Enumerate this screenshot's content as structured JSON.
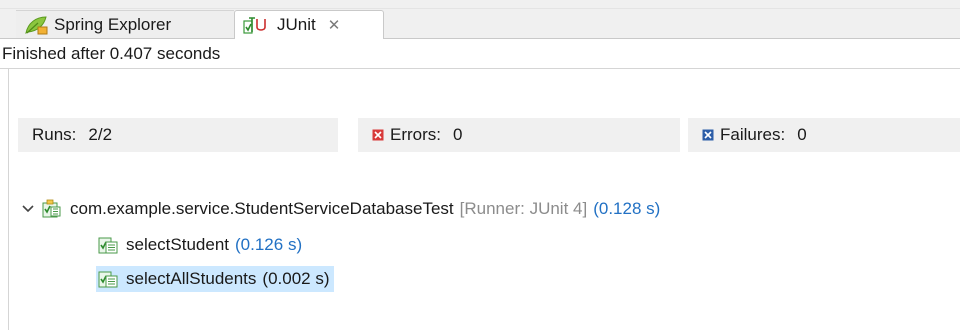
{
  "tabs": [
    {
      "label": "Spring Explorer",
      "active": false,
      "icon": "spring-leaf-icon"
    },
    {
      "label": "JUnit",
      "active": true,
      "icon": "junit-icon",
      "close_glyph": "✕"
    }
  ],
  "status": "Finished after 0.407 seconds",
  "counters": {
    "runs_label": "Runs:",
    "runs_value": "2/2",
    "errors_label": "Errors:",
    "errors_value": "0",
    "failures_label": "Failures:",
    "failures_value": "0"
  },
  "tree": {
    "suite": {
      "label": "com.example.service.StudentServiceDatabaseTest",
      "runner": "[Runner: JUnit 4]",
      "time": "(0.128 s)",
      "expanded": true
    },
    "tests": [
      {
        "label": "selectStudent",
        "time": "(0.126 s)",
        "selected": false
      },
      {
        "label": "selectAllStudents",
        "time": "(0.002 s)",
        "selected": true
      }
    ]
  },
  "colors": {
    "time_blue": "#2271c4",
    "runner_gray": "#8c8c8c",
    "error_red": "#d83a3a",
    "failure_blue": "#2d5ea8",
    "selection": "#cce8ff"
  }
}
